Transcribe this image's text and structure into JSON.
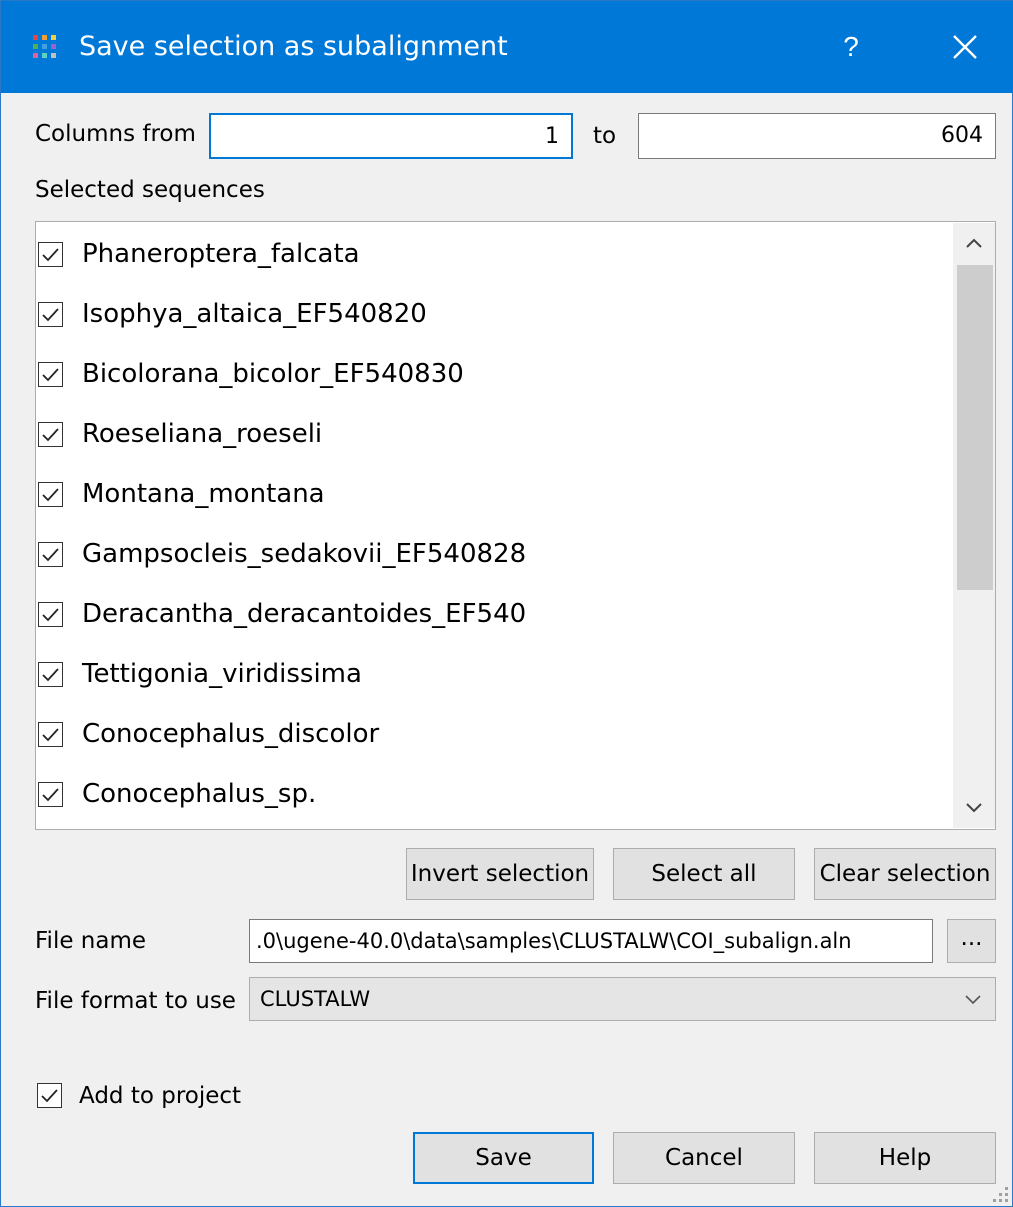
{
  "window": {
    "title": "Save selection as subalignment",
    "help_glyph": "?",
    "accent_color": "#0078d7",
    "icons": {
      "app": "grid-icon",
      "close": "close-icon"
    }
  },
  "columns": {
    "from_label": "Columns from",
    "from_value": "1",
    "to_label": "to",
    "to_value": "604"
  },
  "sequences": {
    "label": "Selected sequences",
    "items": [
      {
        "name": "Phaneroptera_falcata",
        "checked": true
      },
      {
        "name": "Isophya_altaica_EF540820",
        "checked": true
      },
      {
        "name": "Bicolorana_bicolor_EF540830",
        "checked": true
      },
      {
        "name": "Roeseliana_roeseli",
        "checked": true
      },
      {
        "name": "Montana_montana",
        "checked": true
      },
      {
        "name": "Gampsocleis_sedakovii_EF540828",
        "checked": true
      },
      {
        "name": "Deracantha_deracantoides_EF540",
        "checked": true
      },
      {
        "name": "Tettigonia_viridissima",
        "checked": true
      },
      {
        "name": "Conocephalus_discolor",
        "checked": true
      },
      {
        "name": "Conocephalus_sp.",
        "checked": true
      }
    ]
  },
  "selection_buttons": {
    "invert": "Invert selection",
    "select_all": "Select all",
    "clear": "Clear selection"
  },
  "file": {
    "name_label": "File name",
    "name_value": ".0\\ugene-40.0\\data\\samples\\CLUSTALW\\COI_subalign.aln",
    "browse_label": "...",
    "format_label": "File format to use",
    "format_value": "CLUSTALW"
  },
  "add_to_project": {
    "label": "Add to project",
    "checked": true
  },
  "footer": {
    "save": "Save",
    "cancel": "Cancel",
    "help": "Help"
  }
}
